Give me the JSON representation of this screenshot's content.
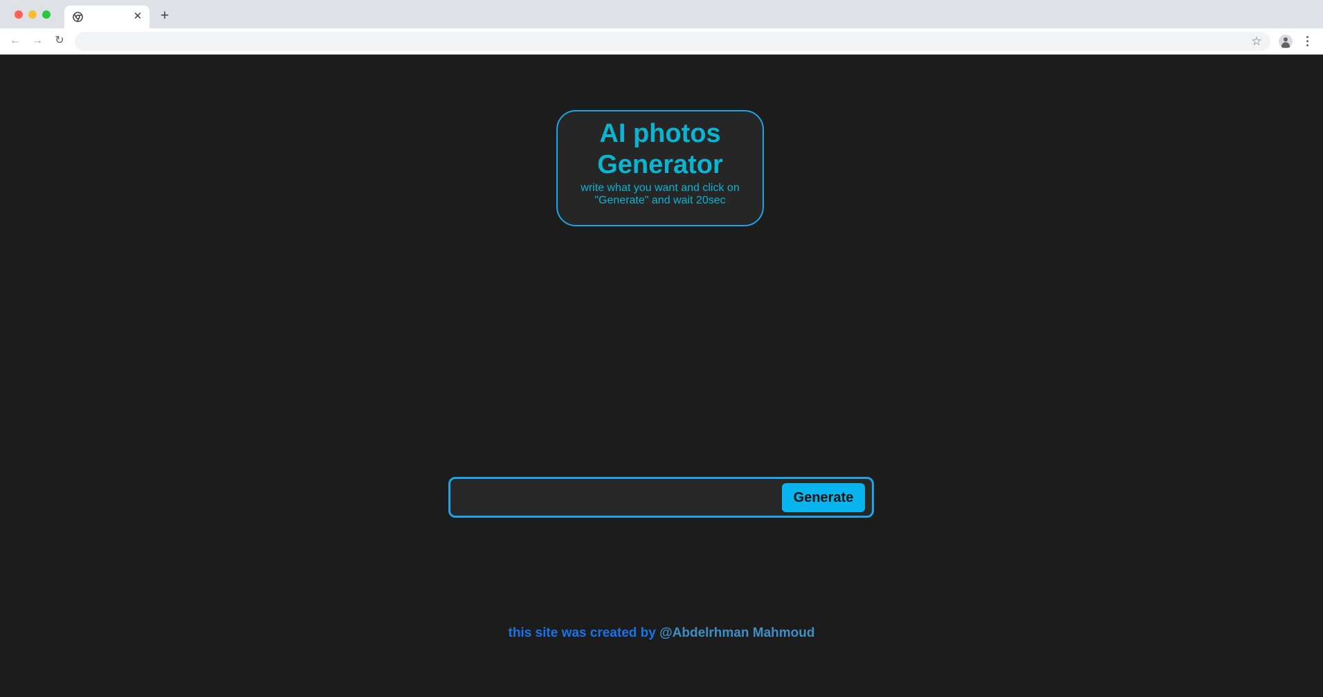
{
  "browser": {
    "tab_title": "",
    "new_tab_label": "+",
    "close_tab_label": "✕",
    "address": ""
  },
  "header": {
    "title": "AI photos Generator",
    "subtitle": "write what you want and click on \"Generate\" and wait 20sec"
  },
  "prompt": {
    "value": "",
    "placeholder": "",
    "button_label": "Generate"
  },
  "footer": {
    "text": "this site was created by",
    "author": "@Abdelrhman Mahmoud"
  },
  "colors": {
    "background": "#1c1c1c",
    "accent_border": "#1ba6e8",
    "title": "#0bb4d1",
    "button": "#08b4ee",
    "footer_text": "#1a73e8",
    "footer_author": "#3f8fc4"
  }
}
